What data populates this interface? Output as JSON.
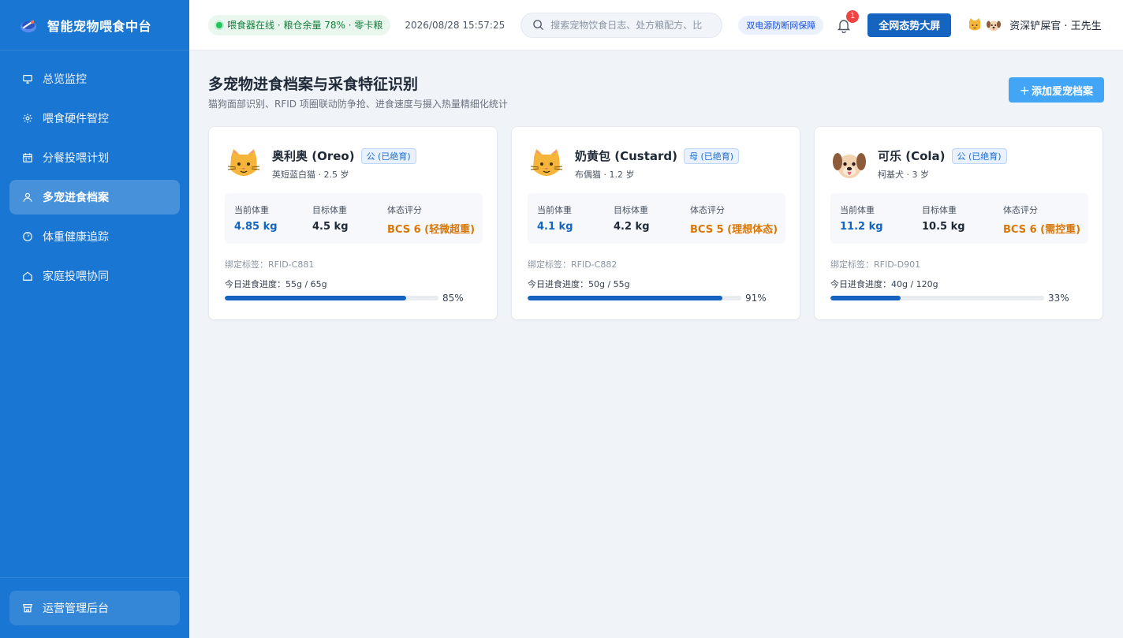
{
  "brand": {
    "title": "智能宠物喂食中台"
  },
  "sidebar": {
    "items": [
      {
        "label": "总览监控",
        "icon": "monitor-icon",
        "active": false
      },
      {
        "label": "喂食硬件智控",
        "icon": "gear-icon",
        "active": false
      },
      {
        "label": "分餐投喂计划",
        "icon": "calendar-icon",
        "active": false
      },
      {
        "label": "多宠进食档案",
        "icon": "user-icon",
        "active": true
      },
      {
        "label": "体重健康追踪",
        "icon": "gauge-icon",
        "active": false
      },
      {
        "label": "家庭投喂协同",
        "icon": "home-icon",
        "active": false
      }
    ],
    "admin_label": "运营管理后台"
  },
  "header": {
    "status": "喂食器在线 · 粮仓余量 78% · 零卡粮",
    "datetime": "2026/08/28 15:57:25",
    "search_placeholder": "搜索宠物饮食日志、处方粮配方、比",
    "power_badge": "双电源防断网保障",
    "notifications": "1",
    "bigscreen_label": "全网态势大屏",
    "user_name": "资深铲屎官 · 王先生"
  },
  "main": {
    "title": "多宠物进食档案与采食特征识别",
    "subtitle": "猫狗面部识别、RFID 项圈联动防争抢、进食速度与摄入热量精细化统计",
    "add_button": "添加爱宠档案",
    "add_plus": "+"
  },
  "labels": {
    "current_weight": "当前体重",
    "target_weight": "目标体重",
    "body_score": "体态评分"
  },
  "pets": [
    {
      "name": "奥利奥 (Oreo)",
      "gender": "公 (已绝育)",
      "breed": "英短蓝白猫 · 2.5 岁",
      "species": "cat",
      "current_weight": "4.85 kg",
      "target_weight": "4.5 kg",
      "bcs": "BCS 6 (轻微超重)",
      "rfid": "绑定标签：RFID-C881",
      "progress_label": "今日进食进度：55g / 65g",
      "progress": 0.85,
      "progress_pct": "85%"
    },
    {
      "name": "奶黄包 (Custard)",
      "gender": "母 (已绝育)",
      "breed": "布偶猫 · 1.2 岁",
      "species": "cat",
      "current_weight": "4.1 kg",
      "target_weight": "4.2 kg",
      "bcs": "BCS 5 (理想体态)",
      "rfid": "绑定标签：RFID-C882",
      "progress_label": "今日进食进度：50g / 55g",
      "progress": 0.91,
      "progress_pct": "91%"
    },
    {
      "name": "可乐 (Cola)",
      "gender": "公 (已绝育)",
      "breed": "柯基犬 · 3 岁",
      "species": "dog",
      "current_weight": "11.2 kg",
      "target_weight": "10.5 kg",
      "bcs": "BCS 6 (需控重)",
      "rfid": "绑定标签：RFID-D901",
      "progress_label": "今日进食进度：40g / 120g",
      "progress": 0.33,
      "progress_pct": "33%"
    }
  ],
  "colors": {
    "sidebar": "#1976d2",
    "primary": "#1565c0",
    "accent": "#42a5f5",
    "online": "#22c55e",
    "warning": "#d97706",
    "badge": "#ef4444"
  }
}
